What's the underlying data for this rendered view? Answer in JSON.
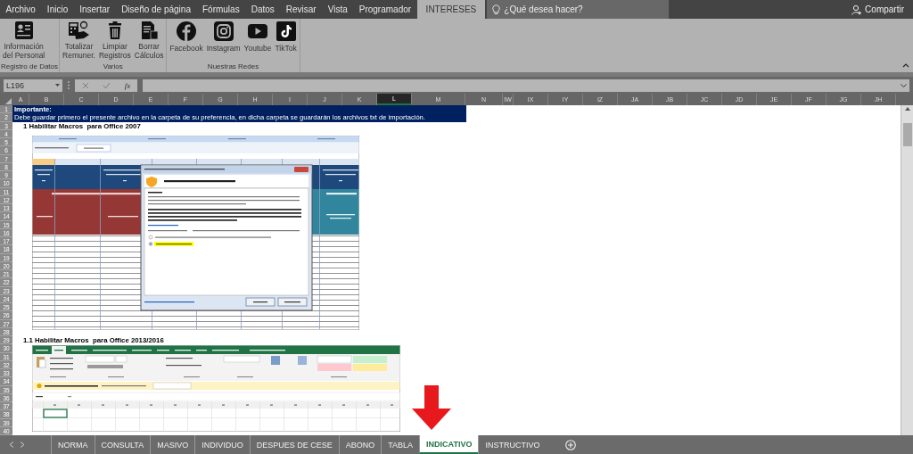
{
  "menu_tabs": [
    {
      "label": "Archivo",
      "selected": false
    },
    {
      "label": "Inicio",
      "selected": false
    },
    {
      "label": "Insertar",
      "selected": false
    },
    {
      "label": "Diseño de página",
      "selected": false
    },
    {
      "label": "Fórmulas",
      "selected": false
    },
    {
      "label": "Datos",
      "selected": false
    },
    {
      "label": "Revisar",
      "selected": false
    },
    {
      "label": "Vista",
      "selected": false
    },
    {
      "label": "Programador",
      "selected": false
    },
    {
      "label": "INTERESES",
      "selected": true
    }
  ],
  "search": {
    "placeholder": "¿Qué desea hacer?"
  },
  "share_button": "Compartir",
  "ribbon_groups": [
    {
      "label": "Registro de Datos",
      "buttons": [
        {
          "kind": "id-card",
          "lines": [
            "Información",
            "del Personal"
          ]
        }
      ]
    },
    {
      "label": "Varios",
      "buttons": [
        {
          "kind": "calculator",
          "lines": [
            "Totalizar",
            "Remuner."
          ]
        },
        {
          "kind": "trash",
          "lines": [
            "Limpiar",
            "Registros"
          ]
        },
        {
          "kind": "document",
          "lines": [
            "Borrar",
            "Cálculos"
          ]
        }
      ]
    },
    {
      "label": "Nuestras Redes",
      "buttons": [
        {
          "kind": "facebook",
          "lines": [
            "Facebook"
          ]
        },
        {
          "kind": "instagram",
          "lines": [
            "Instagram"
          ]
        },
        {
          "kind": "youtube",
          "lines": [
            "Youtube"
          ]
        },
        {
          "kind": "tiktok",
          "lines": [
            "TikTok"
          ]
        }
      ]
    }
  ],
  "formula_bar": {
    "name_box": "L196",
    "function_label": "fx"
  },
  "columns": [
    {
      "label": "A",
      "selected": false
    },
    {
      "label": "B",
      "selected": false
    },
    {
      "label": "C",
      "selected": false
    },
    {
      "label": "D",
      "selected": false
    },
    {
      "label": "E",
      "selected": false
    },
    {
      "label": "F",
      "selected": false
    },
    {
      "label": "G",
      "selected": false
    },
    {
      "label": "H",
      "selected": false
    },
    {
      "label": "I",
      "selected": false
    },
    {
      "label": "J",
      "selected": false
    },
    {
      "label": "K",
      "selected": false
    },
    {
      "label": "L",
      "selected": true
    },
    {
      "label": "M",
      "selected": false
    },
    {
      "label": "N",
      "selected": false
    },
    {
      "label": "IW",
      "selected": false
    },
    {
      "label": "IX",
      "selected": false
    },
    {
      "label": "IY",
      "selected": false
    },
    {
      "label": "IZ",
      "selected": false
    },
    {
      "label": "JA",
      "selected": false
    },
    {
      "label": "JB",
      "selected": false
    },
    {
      "label": "JC",
      "selected": false
    },
    {
      "label": "JD",
      "selected": false
    },
    {
      "label": "JE",
      "selected": false
    },
    {
      "label": "JF",
      "selected": false
    },
    {
      "label": "JG",
      "selected": false
    },
    {
      "label": "JH",
      "selected": false
    }
  ],
  "rows": [
    {
      "number": "1",
      "kind": "banner-title",
      "text": "Importante:"
    },
    {
      "number": "2",
      "kind": "banner-text",
      "text": "Debe guardar primero el presente archivo en la carpeta de su preferencia, en dicha carpeta se guardarán los archivos txt de importación."
    },
    {
      "number": "3",
      "kind": "heading",
      "text": "1 Habilitar Macros  para Office 2007"
    },
    {
      "number": "4",
      "kind": "image-2007"
    },
    {
      "number": "5"
    },
    {
      "number": "6"
    },
    {
      "number": "7"
    },
    {
      "number": "8"
    },
    {
      "number": "9"
    },
    {
      "number": "10"
    },
    {
      "number": "11"
    },
    {
      "number": "12"
    },
    {
      "number": "13"
    },
    {
      "number": "14"
    },
    {
      "number": "15"
    },
    {
      "number": "16"
    },
    {
      "number": "17"
    },
    {
      "number": "18"
    },
    {
      "number": "19"
    },
    {
      "number": "20"
    },
    {
      "number": "21"
    },
    {
      "number": "22"
    },
    {
      "number": "23"
    },
    {
      "number": "24"
    },
    {
      "number": "25"
    },
    {
      "number": "26"
    },
    {
      "number": "27"
    },
    {
      "number": "28"
    },
    {
      "number": "29",
      "kind": "heading",
      "text": "1.1 Habilitar Macros  para Office 2013/2016"
    },
    {
      "number": "30",
      "kind": "image-2016"
    },
    {
      "number": "31"
    },
    {
      "number": "32"
    },
    {
      "number": "33"
    },
    {
      "number": "34"
    },
    {
      "number": "35"
    },
    {
      "number": "36"
    },
    {
      "number": "37"
    },
    {
      "number": "38"
    },
    {
      "number": "39"
    },
    {
      "number": "40"
    }
  ],
  "sheet_tabs": [
    {
      "label": "NORMA",
      "selected": false
    },
    {
      "label": "CONSULTA",
      "selected": false
    },
    {
      "label": "MASIVO",
      "selected": false
    },
    {
      "label": "INDIVIDUO",
      "selected": false
    },
    {
      "label": "DESPUES DE CESE",
      "selected": false
    },
    {
      "label": "ABONO",
      "selected": false
    },
    {
      "label": "TABLA",
      "selected": false
    },
    {
      "label": "INDICATIVO",
      "selected": true
    },
    {
      "label": "INSTRUCTIVO",
      "selected": false
    }
  ]
}
